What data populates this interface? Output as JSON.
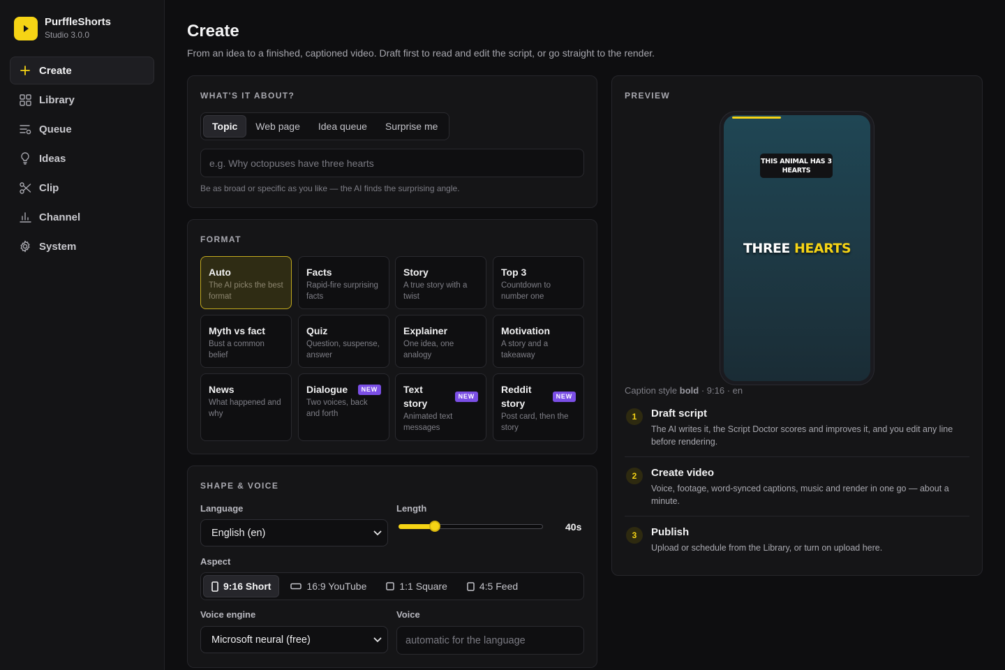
{
  "app": {
    "name": "PurffleShorts",
    "version": "Studio 3.0.0"
  },
  "nav": [
    {
      "label": "Create",
      "icon": "plus-icon",
      "active": true
    },
    {
      "label": "Library",
      "icon": "grid-icon"
    },
    {
      "label": "Queue",
      "icon": "queue-icon"
    },
    {
      "label": "Ideas",
      "icon": "lightbulb-icon"
    },
    {
      "label": "Clip",
      "icon": "scissors-icon"
    },
    {
      "label": "Channel",
      "icon": "bar-chart-icon"
    },
    {
      "label": "System",
      "icon": "gear-icon"
    }
  ],
  "header": {
    "title": "Create",
    "subtitle": "From an idea to a finished, captioned video. Draft first to read and edit the script, or go straight to the render."
  },
  "topic": {
    "heading": "WHAT'S IT ABOUT?",
    "tabs": [
      "Topic",
      "Web page",
      "Idea queue",
      "Surprise me"
    ],
    "active_tab": "Topic",
    "placeholder": "e.g. Why octopuses have three hearts",
    "value": "",
    "hint": "Be as broad or specific as you like — the AI finds the surprising angle."
  },
  "format": {
    "heading": "FORMAT",
    "selected": "Auto",
    "items": [
      {
        "title": "Auto",
        "desc": "The AI picks the best format",
        "badge": ""
      },
      {
        "title": "Facts",
        "desc": "Rapid-fire surprising facts",
        "badge": ""
      },
      {
        "title": "Story",
        "desc": "A true story with a twist",
        "badge": ""
      },
      {
        "title": "Top 3",
        "desc": "Countdown to number one",
        "badge": ""
      },
      {
        "title": "Myth vs fact",
        "desc": "Bust a common belief",
        "badge": ""
      },
      {
        "title": "Quiz",
        "desc": "Question, suspense, answer",
        "badge": ""
      },
      {
        "title": "Explainer",
        "desc": "One idea, one analogy",
        "badge": ""
      },
      {
        "title": "Motivation",
        "desc": "A story and a takeaway",
        "badge": ""
      },
      {
        "title": "News",
        "desc": "What happened and why",
        "badge": ""
      },
      {
        "title": "Dialogue",
        "desc": "Two voices, back and forth",
        "badge": "NEW"
      },
      {
        "title": "Text story",
        "desc": "Animated text messages",
        "badge": "NEW"
      },
      {
        "title": "Reddit story",
        "desc": "Post card, then the story",
        "badge": "NEW"
      }
    ]
  },
  "shape": {
    "heading": "SHAPE & VOICE",
    "language_label": "Language",
    "language_value": "English (en)",
    "length_label": "Length",
    "length_value": "40s",
    "length_fraction": 0.25,
    "aspect_label": "Aspect",
    "aspects": [
      "9:16 Short",
      "16:9 YouTube",
      "1:1 Square",
      "4:5 Feed"
    ],
    "aspect_selected": "9:16 Short",
    "voice_engine_label": "Voice engine",
    "voice_engine_value": "Microsoft neural (free)",
    "voice_label": "Voice",
    "voice_placeholder": "automatic for the language"
  },
  "preview": {
    "heading": "PREVIEW",
    "hook": "THIS ANIMAL HAS 3 HEARTS",
    "caption_word1": "THREE",
    "caption_word2": "HEARTS",
    "meta_prefix": "Caption style",
    "meta_style": "bold",
    "meta_rest": "· 9:16 · en",
    "progress_fraction": 0.35
  },
  "steps": [
    {
      "num": "1",
      "title": "Draft script",
      "desc": "The AI writes it, the Script Doctor scores and improves it, and you edit any line before rendering."
    },
    {
      "num": "2",
      "title": "Create video",
      "desc": "Voice, footage, word-synced captions, music and render in one go — about a minute."
    },
    {
      "num": "3",
      "title": "Publish",
      "desc": "Upload or schedule from the Library, or turn on upload here."
    }
  ],
  "colors": {
    "accent": "#f6d415",
    "badge": "#7b4fe6",
    "background": "#0e0e10"
  }
}
